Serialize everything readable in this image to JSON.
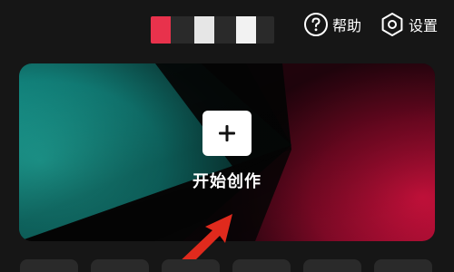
{
  "header": {
    "help_label": "帮助",
    "settings_label": "设置",
    "help_icon": "question-circle-icon",
    "settings_icon": "hexagon-gear-icon",
    "color_strip": [
      "#e8324c",
      "#2a2a2a",
      "#e6e6e6",
      "#2a2a2a",
      "#f2f2f2",
      "#2a2a2a"
    ]
  },
  "create_card": {
    "label": "开始创作",
    "icon": "plus-icon",
    "gradient_colors": {
      "teal": "#1aa39a",
      "black": "#050505",
      "crimson": "#c8103a"
    }
  },
  "annotation": {
    "arrow_color": "#e02a1d"
  },
  "tools": {
    "tile_count_visible": 6
  }
}
